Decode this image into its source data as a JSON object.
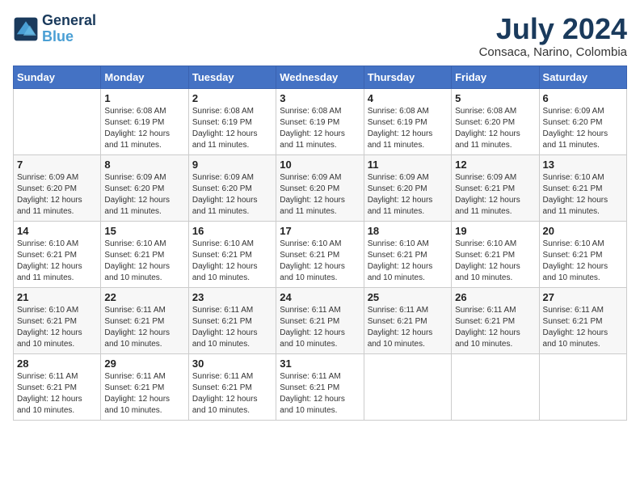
{
  "logo": {
    "line1": "General",
    "line2": "Blue"
  },
  "title": {
    "month_year": "July 2024",
    "location": "Consaca, Narino, Colombia"
  },
  "weekdays": [
    "Sunday",
    "Monday",
    "Tuesday",
    "Wednesday",
    "Thursday",
    "Friday",
    "Saturday"
  ],
  "weeks": [
    [
      {
        "day": "",
        "sunrise": "",
        "sunset": "",
        "daylight": ""
      },
      {
        "day": "1",
        "sunrise": "6:08 AM",
        "sunset": "6:19 PM",
        "daylight": "12 hours and 11 minutes."
      },
      {
        "day": "2",
        "sunrise": "6:08 AM",
        "sunset": "6:19 PM",
        "daylight": "12 hours and 11 minutes."
      },
      {
        "day": "3",
        "sunrise": "6:08 AM",
        "sunset": "6:19 PM",
        "daylight": "12 hours and 11 minutes."
      },
      {
        "day": "4",
        "sunrise": "6:08 AM",
        "sunset": "6:19 PM",
        "daylight": "12 hours and 11 minutes."
      },
      {
        "day": "5",
        "sunrise": "6:08 AM",
        "sunset": "6:20 PM",
        "daylight": "12 hours and 11 minutes."
      },
      {
        "day": "6",
        "sunrise": "6:09 AM",
        "sunset": "6:20 PM",
        "daylight": "12 hours and 11 minutes."
      }
    ],
    [
      {
        "day": "7",
        "sunrise": "6:09 AM",
        "sunset": "6:20 PM",
        "daylight": "12 hours and 11 minutes."
      },
      {
        "day": "8",
        "sunrise": "6:09 AM",
        "sunset": "6:20 PM",
        "daylight": "12 hours and 11 minutes."
      },
      {
        "day": "9",
        "sunrise": "6:09 AM",
        "sunset": "6:20 PM",
        "daylight": "12 hours and 11 minutes."
      },
      {
        "day": "10",
        "sunrise": "6:09 AM",
        "sunset": "6:20 PM",
        "daylight": "12 hours and 11 minutes."
      },
      {
        "day": "11",
        "sunrise": "6:09 AM",
        "sunset": "6:20 PM",
        "daylight": "12 hours and 11 minutes."
      },
      {
        "day": "12",
        "sunrise": "6:09 AM",
        "sunset": "6:21 PM",
        "daylight": "12 hours and 11 minutes."
      },
      {
        "day": "13",
        "sunrise": "6:10 AM",
        "sunset": "6:21 PM",
        "daylight": "12 hours and 11 minutes."
      }
    ],
    [
      {
        "day": "14",
        "sunrise": "6:10 AM",
        "sunset": "6:21 PM",
        "daylight": "12 hours and 11 minutes."
      },
      {
        "day": "15",
        "sunrise": "6:10 AM",
        "sunset": "6:21 PM",
        "daylight": "12 hours and 10 minutes."
      },
      {
        "day": "16",
        "sunrise": "6:10 AM",
        "sunset": "6:21 PM",
        "daylight": "12 hours and 10 minutes."
      },
      {
        "day": "17",
        "sunrise": "6:10 AM",
        "sunset": "6:21 PM",
        "daylight": "12 hours and 10 minutes."
      },
      {
        "day": "18",
        "sunrise": "6:10 AM",
        "sunset": "6:21 PM",
        "daylight": "12 hours and 10 minutes."
      },
      {
        "day": "19",
        "sunrise": "6:10 AM",
        "sunset": "6:21 PM",
        "daylight": "12 hours and 10 minutes."
      },
      {
        "day": "20",
        "sunrise": "6:10 AM",
        "sunset": "6:21 PM",
        "daylight": "12 hours and 10 minutes."
      }
    ],
    [
      {
        "day": "21",
        "sunrise": "6:10 AM",
        "sunset": "6:21 PM",
        "daylight": "12 hours and 10 minutes."
      },
      {
        "day": "22",
        "sunrise": "6:11 AM",
        "sunset": "6:21 PM",
        "daylight": "12 hours and 10 minutes."
      },
      {
        "day": "23",
        "sunrise": "6:11 AM",
        "sunset": "6:21 PM",
        "daylight": "12 hours and 10 minutes."
      },
      {
        "day": "24",
        "sunrise": "6:11 AM",
        "sunset": "6:21 PM",
        "daylight": "12 hours and 10 minutes."
      },
      {
        "day": "25",
        "sunrise": "6:11 AM",
        "sunset": "6:21 PM",
        "daylight": "12 hours and 10 minutes."
      },
      {
        "day": "26",
        "sunrise": "6:11 AM",
        "sunset": "6:21 PM",
        "daylight": "12 hours and 10 minutes."
      },
      {
        "day": "27",
        "sunrise": "6:11 AM",
        "sunset": "6:21 PM",
        "daylight": "12 hours and 10 minutes."
      }
    ],
    [
      {
        "day": "28",
        "sunrise": "6:11 AM",
        "sunset": "6:21 PM",
        "daylight": "12 hours and 10 minutes."
      },
      {
        "day": "29",
        "sunrise": "6:11 AM",
        "sunset": "6:21 PM",
        "daylight": "12 hours and 10 minutes."
      },
      {
        "day": "30",
        "sunrise": "6:11 AM",
        "sunset": "6:21 PM",
        "daylight": "12 hours and 10 minutes."
      },
      {
        "day": "31",
        "sunrise": "6:11 AM",
        "sunset": "6:21 PM",
        "daylight": "12 hours and 10 minutes."
      },
      {
        "day": "",
        "sunrise": "",
        "sunset": "",
        "daylight": ""
      },
      {
        "day": "",
        "sunrise": "",
        "sunset": "",
        "daylight": ""
      },
      {
        "day": "",
        "sunrise": "",
        "sunset": "",
        "daylight": ""
      }
    ]
  ]
}
